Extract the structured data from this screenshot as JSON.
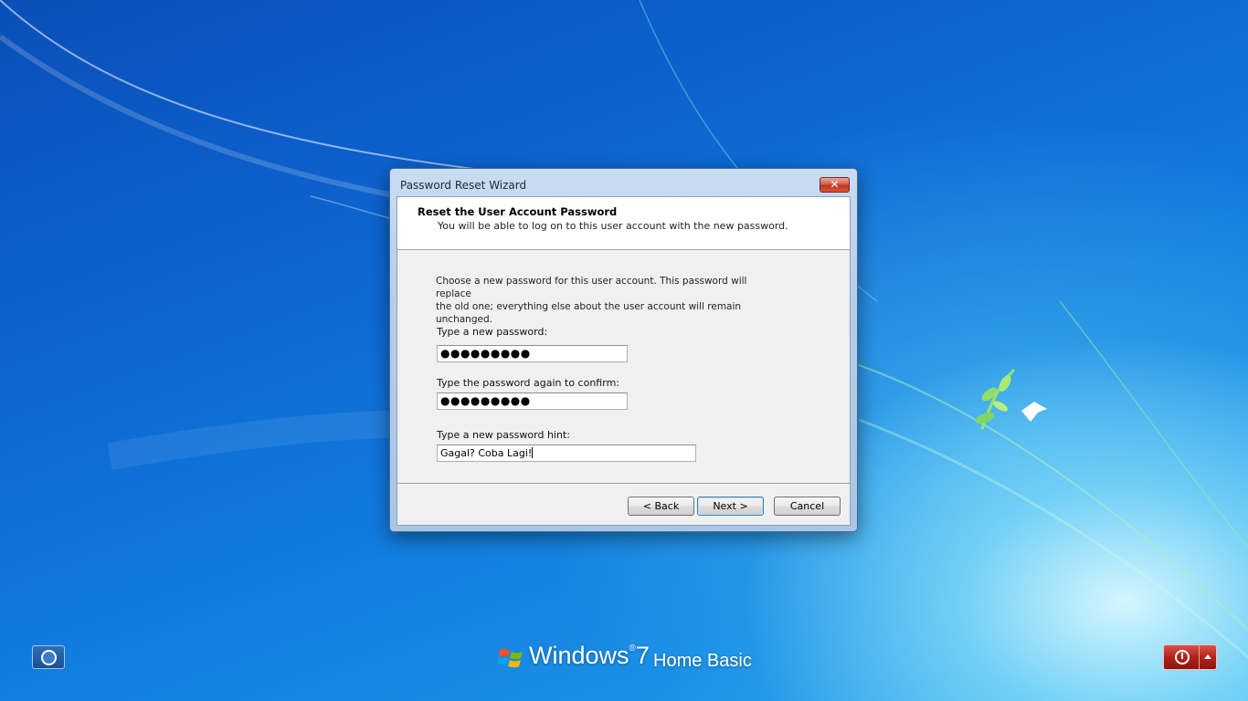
{
  "dialog": {
    "title": "Password Reset Wizard",
    "close_glyph": "✕",
    "header_title": "Reset the User Account Password",
    "header_subtitle": "You will be able to log on to this user account with the new password.",
    "instructions_line1": "Choose a new password for this user account. This password will replace",
    "instructions_line2": "the old one; everything else about the user account will remain unchanged.",
    "new_password_label": "Type a new password:",
    "new_password_value": "●●●●●●●●●",
    "confirm_password_label": "Type the password again to confirm:",
    "confirm_password_value": "●●●●●●●●●",
    "hint_label": "Type a new password hint:",
    "hint_value": "Gagal? Coba Lagi!",
    "back_label": "< Back",
    "next_label": "Next >",
    "cancel_label": "Cancel"
  },
  "branding": {
    "product": "Windows",
    "version": "7",
    "edition": "Home Basic"
  },
  "icons": {
    "ease_of_access": "ease-of-access-icon",
    "power": "power-icon",
    "power_options": "chevron-up-icon",
    "windows_logo": "windows-flag-icon"
  },
  "colors": {
    "power_button": "#b0231a",
    "desktop_blue": "#0d63cf",
    "dialog_frame": "#b4cde8"
  }
}
